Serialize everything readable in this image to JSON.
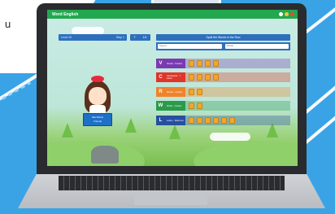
{
  "background": {
    "side_text": "u",
    "accent": "#3aa3e6"
  },
  "app": {
    "title": "Word English",
    "header_color": "#22a84f",
    "header_icons": [
      {
        "name": "help-icon",
        "color": "#ffffff"
      },
      {
        "name": "star-icon",
        "color": "#f2c53d"
      },
      {
        "name": "close-icon",
        "color": "#e24b3a"
      }
    ]
  },
  "left_bar": {
    "label": "Level 10",
    "value": "Step 1"
  },
  "mini_button": {
    "left": "T",
    "right": "1/4"
  },
  "main_header": {
    "label": "Spell the Words in the Row"
  },
  "inputs": [
    {
      "placeholder": "Type it"
    },
    {
      "placeholder": "Check"
    }
  ],
  "rows": [
    {
      "letter": "V",
      "color": "#7a3bb0",
      "info": "Vowels · 5 letters",
      "tiles": 4,
      "tile_color": "#f4a62a"
    },
    {
      "letter": "C",
      "color": "#e0352a",
      "info": "Consonants · 7 letters",
      "tiles": 4,
      "tile_color": "#f4a62a"
    },
    {
      "letter": "R",
      "color": "#f0832a",
      "info": "Review · 3 letters",
      "tiles": 2,
      "tile_color": "#f4a62a"
    },
    {
      "letter": "W",
      "color": "#2b9a4a",
      "info": "Words · 2 letters",
      "tiles": 2,
      "tile_color": "#f4a62a"
    },
    {
      "letter": "L",
      "color": "#274fa0",
      "info": "Letters · Mixed set",
      "tiles": 6,
      "tile_color": "#f4a62a"
    }
  ],
  "character_sign": {
    "line1": "Mia Wants",
    "line2": "Friends"
  }
}
